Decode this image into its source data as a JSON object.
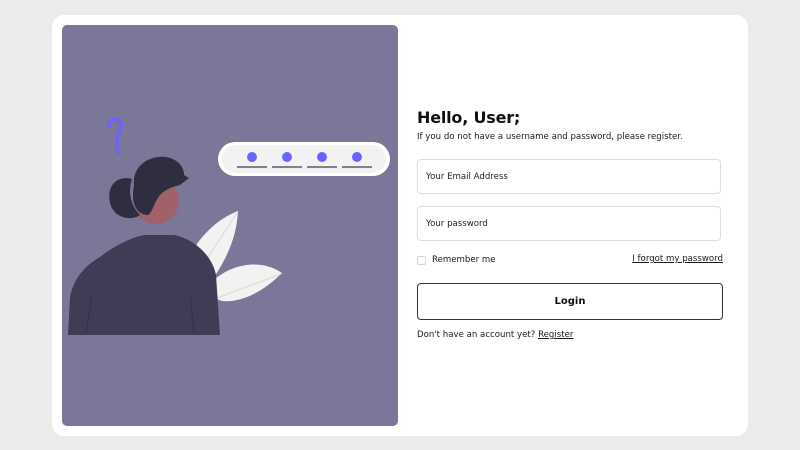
{
  "login": {
    "title": "Hello, User;",
    "subtitle": "If you do not have a username and password, please register.",
    "email": {
      "value": "",
      "placeholder": "Your Email Address"
    },
    "password": {
      "value": "",
      "placeholder": "Your password"
    },
    "remember_label": "Remember me",
    "remember_checked": false,
    "forgot_label": "I forgot my password",
    "login_label": "Login",
    "register_prompt": "Don't have an account yet?",
    "register_label": "Register"
  },
  "illustration": {
    "icons": [
      "question-mark-icon",
      "password-dots-icon",
      "person-figure-icon",
      "leaf-icon"
    ]
  },
  "colors": {
    "page_background": "#ebebeb",
    "panel": "#7a7799",
    "accent": "#6c63ff",
    "text": "#111111"
  }
}
